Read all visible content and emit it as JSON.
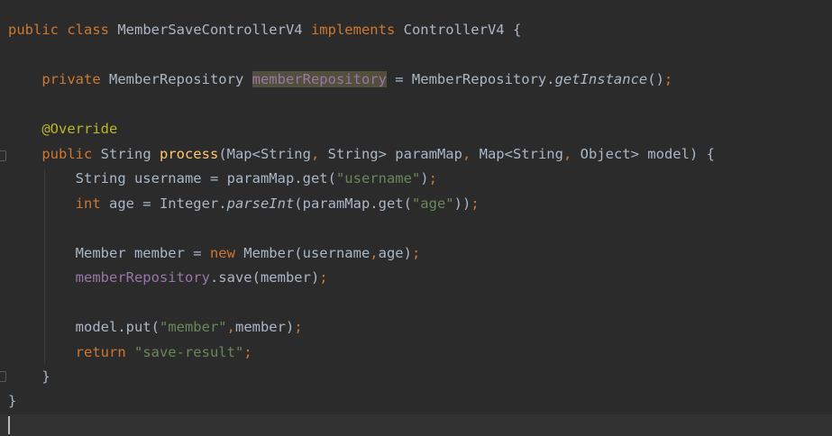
{
  "editor": {
    "lines": [
      {
        "tokens": [
          [
            "kw",
            "public class "
          ],
          [
            "pl",
            "MemberSaveControllerV4 "
          ],
          [
            "kw",
            "implements "
          ],
          [
            "pl",
            "ControllerV4 {"
          ]
        ]
      },
      {
        "tokens": []
      },
      {
        "tokens": [
          [
            "pl",
            "    "
          ],
          [
            "kw",
            "private "
          ],
          [
            "pl",
            "MemberRepository "
          ],
          [
            "fld-hl",
            "memberRepository"
          ],
          [
            "pl",
            " = MemberRepository."
          ],
          [
            "ita",
            "getInstance"
          ],
          [
            "pl",
            "()"
          ],
          [
            "kw",
            ";"
          ]
        ]
      },
      {
        "tokens": []
      },
      {
        "tokens": [
          [
            "pl",
            "    "
          ],
          [
            "ann",
            "@Override"
          ]
        ]
      },
      {
        "tokens": [
          [
            "pl",
            "    "
          ],
          [
            "kw",
            "public "
          ],
          [
            "pl",
            "String "
          ],
          [
            "mth",
            "process"
          ],
          [
            "pl",
            "(Map<String"
          ],
          [
            "kw",
            ", "
          ],
          [
            "pl",
            "String> paramMap"
          ],
          [
            "kw",
            ", "
          ],
          [
            "pl",
            "Map<String"
          ],
          [
            "kw",
            ", "
          ],
          [
            "pl",
            "Object> model) {"
          ]
        ]
      },
      {
        "tokens": [
          [
            "pl",
            "        String username = paramMap.get("
          ],
          [
            "str",
            "\"username\""
          ],
          [
            "pl",
            ")"
          ],
          [
            "kw",
            ";"
          ]
        ]
      },
      {
        "tokens": [
          [
            "pl",
            "        "
          ],
          [
            "kw",
            "int "
          ],
          [
            "pl",
            "age = Integer."
          ],
          [
            "ita",
            "parseInt"
          ],
          [
            "pl",
            "(paramMap.get("
          ],
          [
            "str",
            "\"age\""
          ],
          [
            "pl",
            "))"
          ],
          [
            "kw",
            ";"
          ]
        ]
      },
      {
        "tokens": []
      },
      {
        "tokens": [
          [
            "pl",
            "        Member member = "
          ],
          [
            "kw",
            "new "
          ],
          [
            "pl",
            "Member(username"
          ],
          [
            "kw",
            ","
          ],
          [
            "pl",
            "age)"
          ],
          [
            "kw",
            ";"
          ]
        ]
      },
      {
        "tokens": [
          [
            "pl",
            "        "
          ],
          [
            "fld",
            "memberRepository"
          ],
          [
            "pl",
            ".save(member)"
          ],
          [
            "kw",
            ";"
          ]
        ]
      },
      {
        "tokens": []
      },
      {
        "tokens": [
          [
            "pl",
            "        model.put("
          ],
          [
            "str",
            "\"member\""
          ],
          [
            "kw",
            ","
          ],
          [
            "pl",
            "member)"
          ],
          [
            "kw",
            ";"
          ]
        ]
      },
      {
        "tokens": [
          [
            "pl",
            "        "
          ],
          [
            "kw",
            "return "
          ],
          [
            "str",
            "\"save-result\""
          ],
          [
            "kw",
            ";"
          ]
        ]
      },
      {
        "tokens": [
          [
            "pl",
            "    }"
          ]
        ]
      },
      {
        "tokens": [
          [
            "pl",
            "}"
          ]
        ]
      },
      {
        "tokens": []
      }
    ]
  }
}
